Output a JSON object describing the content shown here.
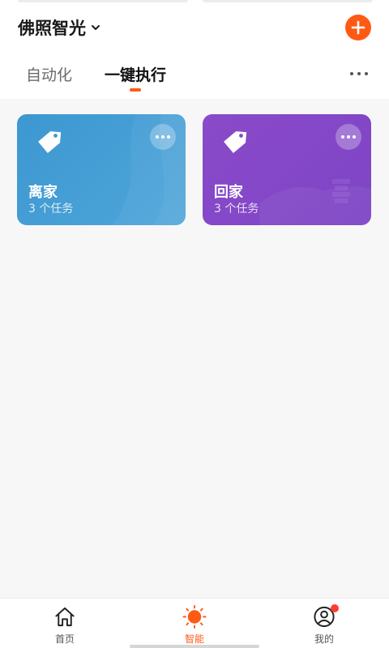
{
  "header": {
    "home_name": "佛照智光",
    "home_dropdown_icon": "chevron-down-icon",
    "add_icon": "plus-icon",
    "accent_color": "#ff5a14"
  },
  "tabs": [
    {
      "label": "自动化",
      "active": false
    },
    {
      "label": "一键执行",
      "active": true
    }
  ],
  "more_icon": "ellipsis-icon",
  "scenes": [
    {
      "title": "离家",
      "subtitle": "3 个任务",
      "icon": "tag-icon",
      "color": "#3d97d1"
    },
    {
      "title": "回家",
      "subtitle": "3 个任务",
      "icon": "tag-icon",
      "color": "#8a4ac9"
    }
  ],
  "bottom_nav": [
    {
      "label": "首页",
      "icon": "home-icon",
      "active": false
    },
    {
      "label": "智能",
      "icon": "sun-icon",
      "active": true
    },
    {
      "label": "我的",
      "icon": "user-icon",
      "active": false,
      "badge": true
    }
  ]
}
